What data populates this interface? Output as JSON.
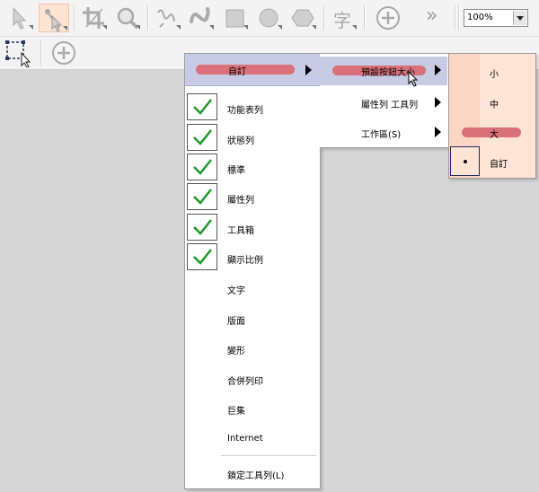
{
  "toolbar": {
    "zoom_value": "100%",
    "text_tool_glyph": "字",
    "overflow_glyph": "»",
    "tools": [
      "pick-tool-icon",
      "shape-tool-icon",
      "crop-tool-icon",
      "zoom-tool-icon",
      "freehand-tool-icon",
      "artistic-media-icon",
      "rectangle-tool-icon",
      "ellipse-tool-icon",
      "polygon-tool-icon",
      "text-tool-icon",
      "add-tool-icon",
      "more-tools-icon"
    ],
    "secondary_tools": [
      "transform-select-icon",
      "add-tool-icon"
    ]
  },
  "menu1": {
    "header": "自訂",
    "items": [
      {
        "label": "功能表列",
        "checked": true
      },
      {
        "label": "狀態列",
        "checked": true
      },
      {
        "label": "標準",
        "checked": true
      },
      {
        "label": "屬性列",
        "checked": true
      },
      {
        "label": "工具箱",
        "checked": true
      },
      {
        "label": "顯示比例",
        "checked": true
      },
      {
        "label": "文字",
        "checked": false
      },
      {
        "label": "版面",
        "checked": false
      },
      {
        "label": "變形",
        "checked": false
      },
      {
        "label": "合併列印",
        "checked": false
      },
      {
        "label": "巨集",
        "checked": false
      },
      {
        "label": "Internet",
        "checked": false
      }
    ],
    "footer": "鎖定工具列(L)"
  },
  "menu2": {
    "items": [
      {
        "label": "預設按鈕大小"
      },
      {
        "label": "屬性列 工具列"
      },
      {
        "label": "工作區(S)"
      }
    ]
  },
  "menu3": {
    "items": [
      {
        "label": "小"
      },
      {
        "label": "中"
      },
      {
        "label": "大"
      },
      {
        "label": "自訂"
      }
    ]
  },
  "colors": {
    "highlight": "#c7cbe3",
    "pill": "#d9707a",
    "check": "#1f9a2b",
    "submenu_bg": "#fde4d4"
  }
}
